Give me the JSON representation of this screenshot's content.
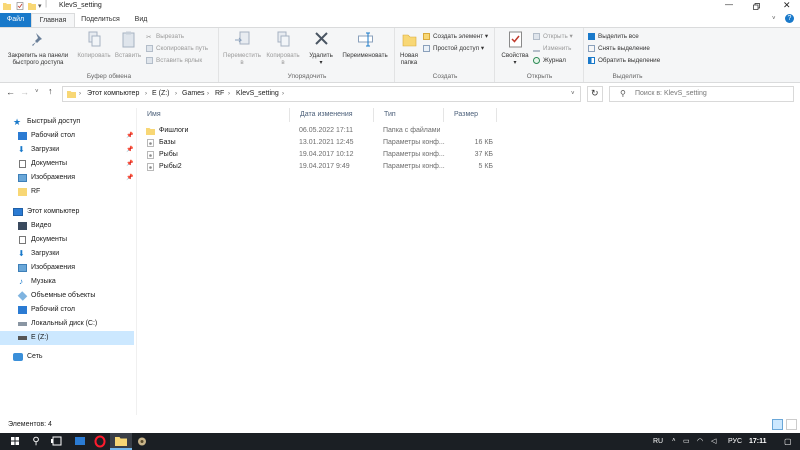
{
  "window": {
    "title": "KlevS_setting"
  },
  "ribbon_tabs": [
    {
      "label": "Файл"
    },
    {
      "label": "Главная"
    },
    {
      "label": "Поделиться"
    },
    {
      "label": "Вид"
    }
  ],
  "ribbon": {
    "clipboard": {
      "label": "Буфер обмена",
      "pin_l1": "Закрепить на панели",
      "pin_l2": "быстрого доступа",
      "copy": "Копировать",
      "paste": "Вставить",
      "cut": "Вырезать",
      "copy_path": "Скопировать путь",
      "paste_shortcut": "Вставить ярлык"
    },
    "organize": {
      "label": "Упорядочить",
      "move_l1": "Переместить",
      "move_l2": "в",
      "copyto_l1": "Копировать",
      "copyto_l2": "в",
      "delete_l1": "Удалить",
      "delete_l2": "▾",
      "rename": "Переименовать"
    },
    "create": {
      "label": "Создать",
      "newfolder_l1": "Новая",
      "newfolder_l2": "папка",
      "new_item": "Создать элемент",
      "easy_access": "Простой доступ"
    },
    "open": {
      "label": "Открыть",
      "props_l1": "Свойства",
      "props_l2": "▾",
      "open": "Открыть",
      "edit": "Изменить",
      "history": "Журнал"
    },
    "select": {
      "label": "Выделить",
      "select_all": "Выделить все",
      "select_none": "Снять выделение",
      "invert": "Обратить выделение"
    }
  },
  "address": {
    "crumbs": [
      "Этот компьютер",
      "E (Z:)",
      "Games",
      "RF",
      "KlevS_setting"
    ],
    "search_placeholder": "Поиск в: KlevS_setting"
  },
  "nav": {
    "quick_access": "Быстрый доступ",
    "quick_items": [
      "Рабочий стол",
      "Загрузки",
      "Документы",
      "Изображения",
      "RF"
    ],
    "this_pc": "Этот компьютер",
    "pc_items": [
      "Видео",
      "Документы",
      "Загрузки",
      "Изображения",
      "Музыка",
      "Объемные объекты",
      "Рабочий стол",
      "Локальный диск (C:)",
      "E (Z:)"
    ],
    "network": "Сеть"
  },
  "columns": {
    "name": "Имя",
    "date": "Дата изменения",
    "type": "Тип",
    "size": "Размер"
  },
  "files": [
    {
      "name": "Фишлоги",
      "date": "06.05.2022 17:11",
      "type": "Папка с файлами",
      "size": ""
    },
    {
      "name": "Базы",
      "date": "13.01.2021 12:45",
      "type": "Параметры конф...",
      "size": "16 КБ"
    },
    {
      "name": "Рыбы",
      "date": "19.04.2017 10:12",
      "type": "Параметры конф...",
      "size": "37 КБ"
    },
    {
      "name": "Рыбы2",
      "date": "19.04.2017 9:49",
      "type": "Параметры конф...",
      "size": "5 КБ"
    }
  ],
  "status": {
    "items_count": "Элементов: 4"
  },
  "taskbar": {
    "lang": "RU",
    "input": "РУС",
    "time": "17:11"
  },
  "colors": {
    "accent": "#1979ca",
    "selection": "#cce8ff",
    "folder": "#f8d775",
    "taskbar": "#1b1f24"
  }
}
